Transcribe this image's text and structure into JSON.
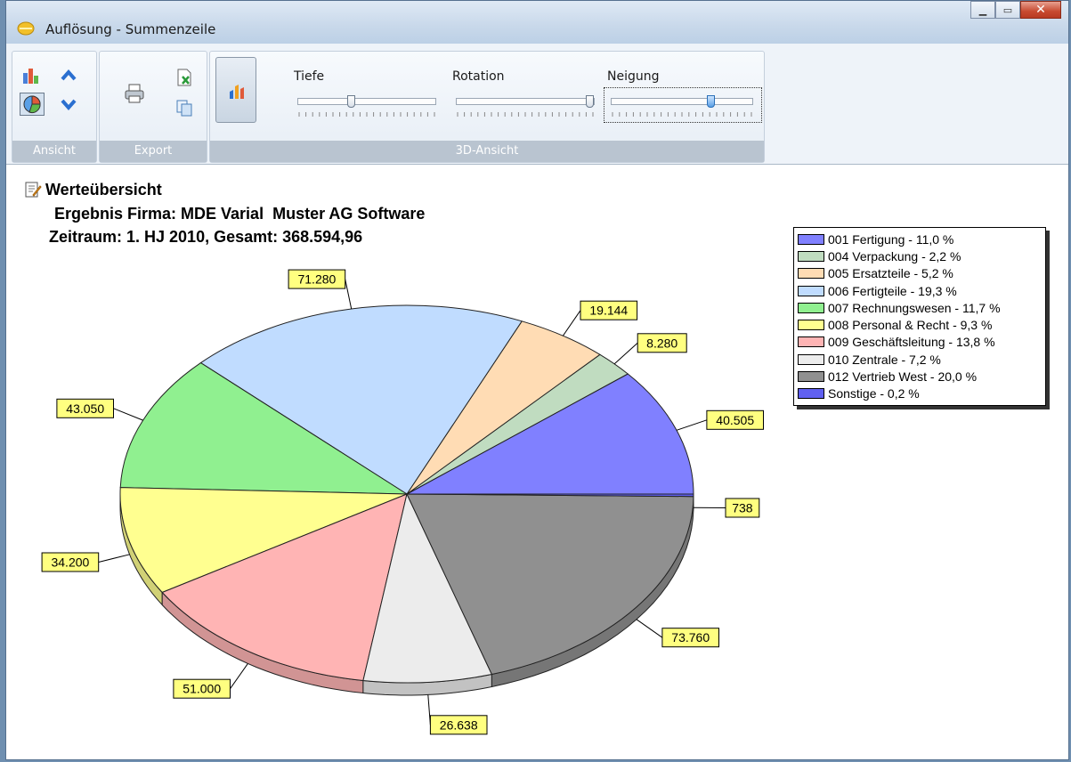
{
  "window": {
    "title": "Auflösung - Summenzeile"
  },
  "ribbon": {
    "groups": {
      "ansicht": "Ansicht",
      "export": "Export",
      "ansicht3d": "3D-Ansicht"
    },
    "sliders": {
      "tiefe": {
        "label": "Tiefe",
        "value": 0.38
      },
      "rotation": {
        "label": "Rotation",
        "value": 1.0
      },
      "neigung": {
        "label": "Neigung",
        "value": 0.72
      }
    }
  },
  "report": {
    "title": "Werteübersicht",
    "company": "Ergebnis Firma: MDE Varial  Muster AG Software",
    "period": "Zeitraum: 1. HJ 2010, Gesamt: 368.594,96"
  },
  "chart_data": {
    "type": "pie",
    "title": "Werteübersicht",
    "slices": [
      {
        "name": "001 Fertigung - 11,0 %",
        "value": 40505,
        "label": "40.505",
        "color": "#8080ff"
      },
      {
        "name": "004 Verpackung - 2,2 %",
        "value": 8280,
        "label": "8.280",
        "color": "#c0dcc0"
      },
      {
        "name": "005 Ersatzteile - 5,2 %",
        "value": 19144,
        "label": "19.144",
        "color": "#ffdcb4"
      },
      {
        "name": "006 Fertigteile - 19,3 %",
        "value": 71280,
        "label": "71.280",
        "color": "#c0dcff"
      },
      {
        "name": "007 Rechnungswesen - 11,7 %",
        "value": 43050,
        "label": "43.050",
        "color": "#90f090"
      },
      {
        "name": "008 Personal & Recht - 9,3 %",
        "value": 34200,
        "label": "34.200",
        "color": "#ffff90"
      },
      {
        "name": "009 Geschäftsleitung - 13,8 %",
        "value": 51000,
        "label": "51.000",
        "color": "#ffb4b4"
      },
      {
        "name": "010 Zentrale - 7,2 %",
        "value": 26638,
        "label": "26.638",
        "color": "#ececec"
      },
      {
        "name": "012 Vertrieb West - 20,0 %",
        "value": 73760,
        "label": "73.760",
        "color": "#909090"
      },
      {
        "name": "Sonstige - 0,2 %",
        "value": 738,
        "label": "738",
        "color": "#6060f0"
      }
    ],
    "legend_position": "top-right",
    "label_style": "yellow boxes",
    "view": "3d"
  }
}
